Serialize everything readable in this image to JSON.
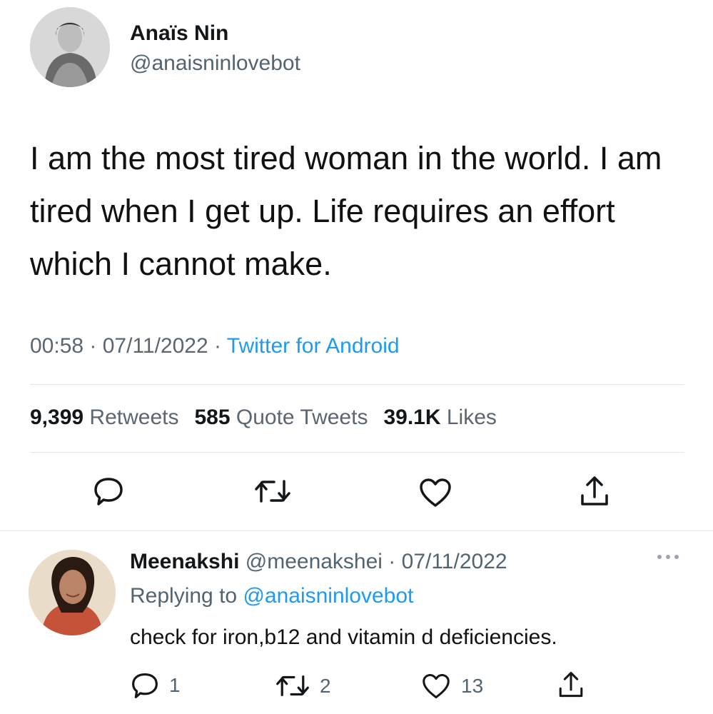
{
  "tweet": {
    "author_name": "Anaïs Nin",
    "author_handle": "@anaisninlovebot",
    "text": "I am the most tired woman in the world. I am tired when I get up. Life requires an effort which I cannot make.",
    "time": "00:58",
    "date": "07/11/2022",
    "source": "Twitter for Android",
    "separator": " · ",
    "stats": {
      "retweets_count": "9,399",
      "retweets_label": "Retweets",
      "quotes_count": "585",
      "quotes_label": "Quote Tweets",
      "likes_count": "39.1K",
      "likes_label": "Likes"
    }
  },
  "reply": {
    "author_name": "Meenakshi",
    "author_handle": "@meenakshei",
    "date": "07/11/2022",
    "replying_prefix": "Replying to",
    "replying_to": "@anaisninlovebot",
    "text": "check for iron,b12 and vitamin d deficiencies.",
    "reply_count": "1",
    "retweet_count": "2",
    "like_count": "13"
  },
  "icons": {
    "reply": "comment-icon",
    "retweet": "retweet-icon",
    "like": "heart-icon",
    "share": "share-icon",
    "more": "more-horizontal-icon"
  },
  "colors": {
    "link": "#1d9bf0",
    "secondary_text": "#536471",
    "primary_text": "#14171a"
  }
}
